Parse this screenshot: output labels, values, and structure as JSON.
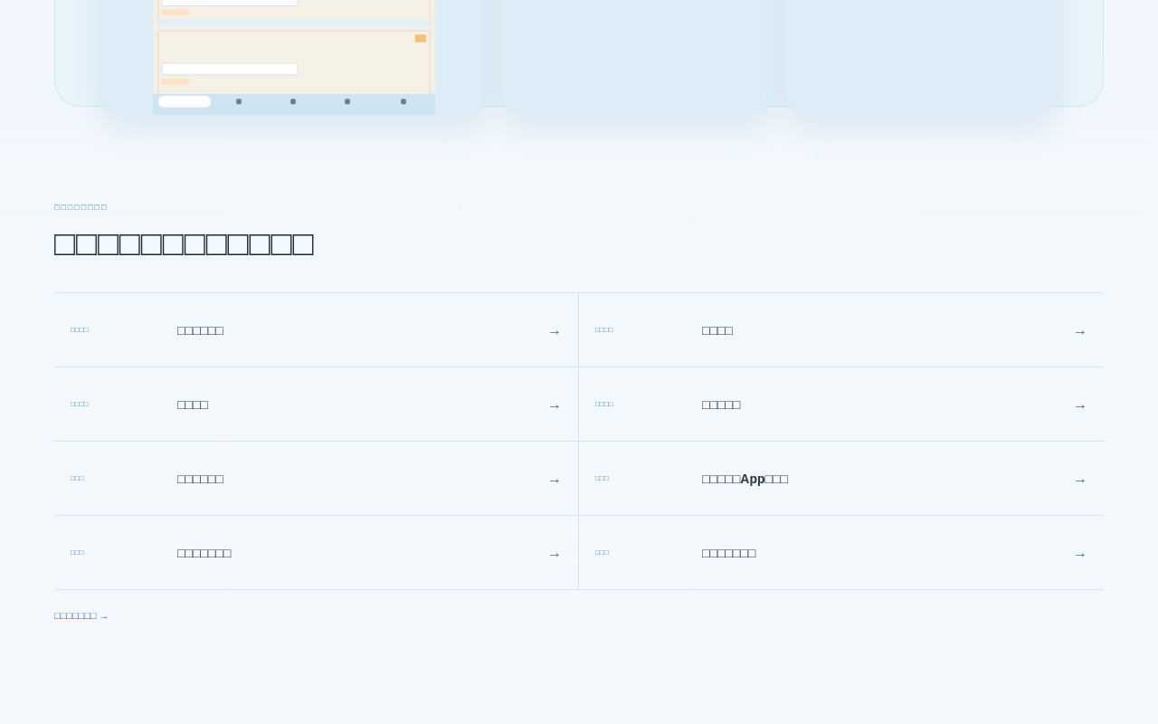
{
  "showcase": {
    "cards": [
      {
        "kind": "picture"
      },
      {
        "kind": "blank"
      },
      {
        "kind": "blank"
      }
    ]
  },
  "section": {
    "eyebrow": "□□□□□□□□",
    "heading": "□□□□□□□□□□□□",
    "rows": [
      {
        "tag": "□□□□",
        "title": "□□□□□□",
        "arrow": "→"
      },
      {
        "tag": "□□□□",
        "title": "□□□□",
        "arrow": "→"
      },
      {
        "tag": "□□□□",
        "title": "□□□□",
        "arrow": "→"
      },
      {
        "tag": "□□□□",
        "title": "□□□□□",
        "arrow": "→"
      },
      {
        "tag": "□□□",
        "title": "□□□□□□",
        "arrow": "→"
      },
      {
        "tag": "□□□",
        "title": "□□□□□**App**□□□",
        "arrow": "→"
      },
      {
        "tag": "□□□",
        "title": "□□□□□□□",
        "arrow": "→"
      },
      {
        "tag": "□□□",
        "title": "□□□□□□□",
        "arrow": "→"
      }
    ],
    "more_link": "□□□□□□□ →"
  }
}
